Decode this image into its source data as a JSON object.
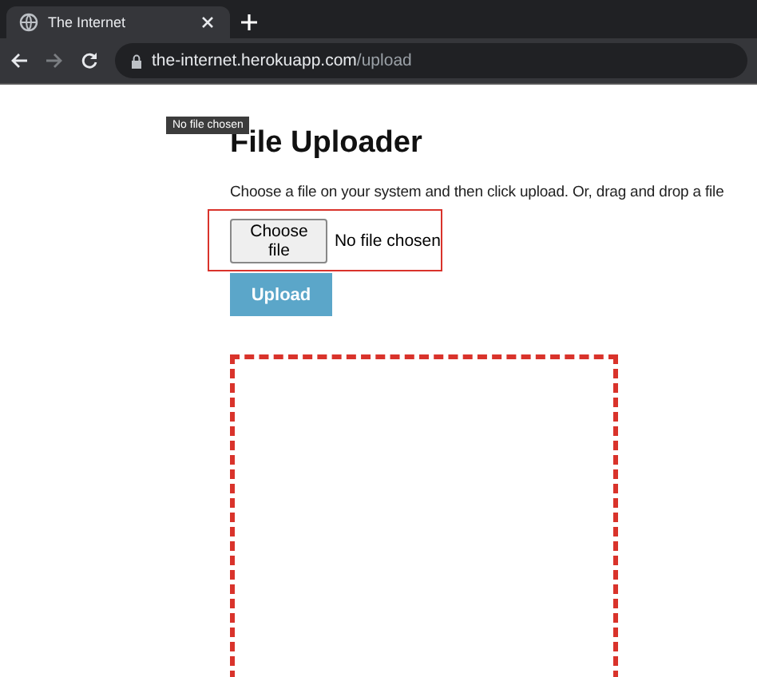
{
  "browser": {
    "tabs": [
      {
        "title": "The Internet",
        "selected": true
      }
    ],
    "url_host": "the-internet.herokuapp.com",
    "url_path": "/upload"
  },
  "tooltip": "No file chosen",
  "page": {
    "heading": "File Uploader",
    "intro": "Choose a file on your system and then click upload. Or, drag and drop a file",
    "file_button": "Choose file",
    "file_status": "No file chosen",
    "highlighted": true,
    "upload_button": "Upload"
  }
}
